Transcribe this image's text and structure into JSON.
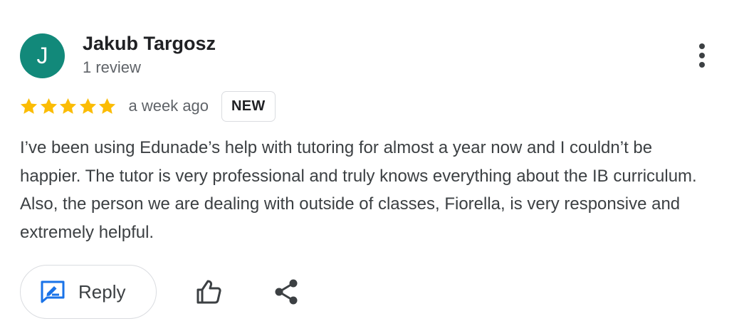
{
  "review": {
    "author": {
      "initial": "J",
      "name": "Jakub Targosz",
      "review_count": "1 review",
      "avatar_color": "#12897a"
    },
    "rating": 5,
    "rating_max": 5,
    "date": "a week ago",
    "badge": "NEW",
    "text": "I’ve been using Edunade’s help with tutoring for almost a year now and I couldn’t be happier. The tutor is very professional and truly knows everything about the IB curriculum. Also, the person we are dealing with outside of classes, Fiorella, is very responsive and extremely helpful."
  },
  "actions": {
    "reply_label": "Reply",
    "reply_icon": "reply-edit-icon",
    "like_icon": "thumbs-up-icon",
    "share_icon": "share-icon",
    "more_icon": "more-vertical-icon"
  },
  "colors": {
    "star": "#fbbc04",
    "accent": "#1a73e8",
    "text_primary": "#202124",
    "text_secondary": "#5f6368",
    "border": "#dadce0"
  }
}
